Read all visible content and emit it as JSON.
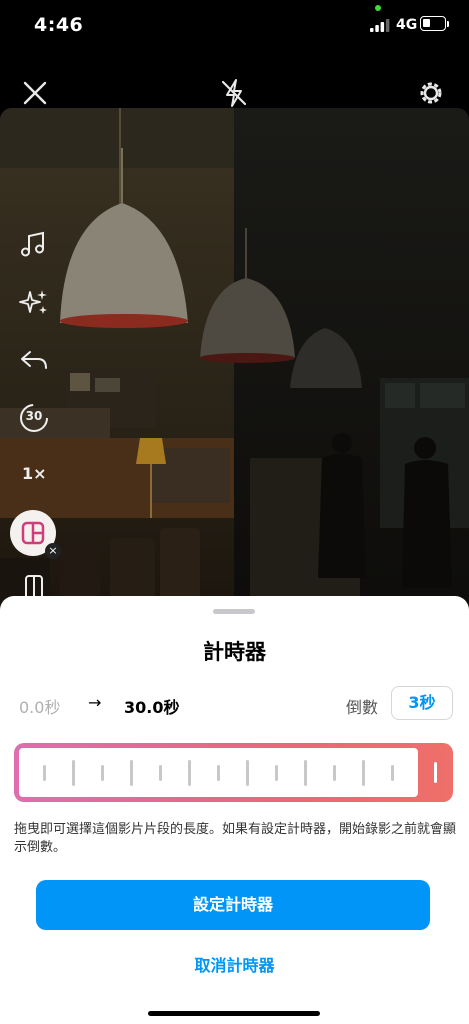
{
  "status_bar": {
    "time": "4:46",
    "network": "4G"
  },
  "camera": {
    "top_icons": [
      "close-icon",
      "flash-off-icon",
      "settings-icon"
    ],
    "side_icons": [
      "music-icon",
      "effects-sparkle-icon",
      "undo-icon",
      "speed-icon",
      "layout-icon",
      "dual-icon"
    ],
    "speed_label": "1×",
    "timer_badge": "30"
  },
  "timer_sheet": {
    "title": "計時器",
    "start_time": "0.0秒",
    "arrow": "→",
    "end_time": "30.0秒",
    "countdown_label": "倒數",
    "countdown_value": "3秒",
    "slider_fill_fraction": 1.0,
    "description": "拖曳即可選擇這個影片片段的長度。如果有設定計時器，開始錄影之前就會顯示倒數。",
    "set_timer_button": "設定計時器",
    "cancel_timer_button": "取消計時器"
  },
  "colors": {
    "accent_blue": "#0095f6",
    "slider_gradient_start": "#e06dae",
    "slider_gradient_end": "#ef6f6a"
  }
}
